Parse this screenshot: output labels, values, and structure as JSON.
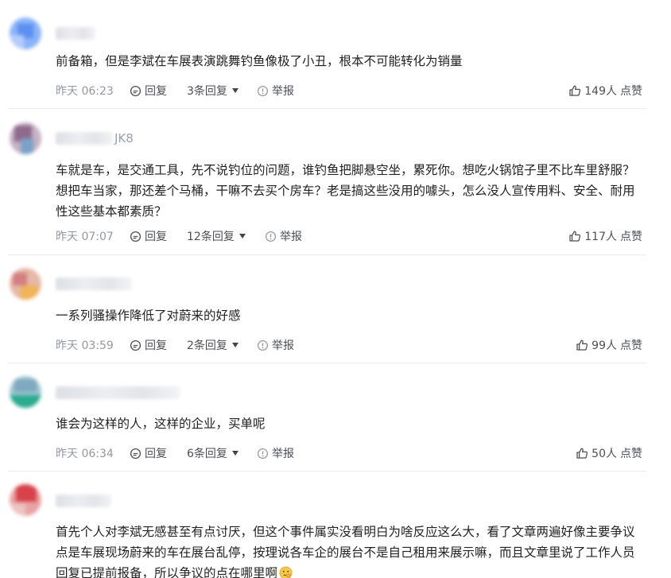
{
  "labels": {
    "reply": "回复",
    "report": "举报",
    "like": "点赞"
  },
  "colors": {
    "text": "#222222",
    "meta": "#9499a0",
    "divider": "#ececec"
  },
  "comments": [
    {
      "username_tail": "",
      "text": "前备箱，但是李斌在车展表演跳舞钓鱼像极了小丑，根本不可能转化为销量",
      "time": "昨天 06:23",
      "replies": "3条回复",
      "likes": "149人"
    },
    {
      "username_tail": "JK8",
      "text": "车就是车，是交通工具，先不说钓位的问题，谁钓鱼把脚悬空坐，累死你。想吃火锅馆子里不比车里舒服？想把车当家，那还差个马桶，干嘛不去买个房车？老是搞这些没用的噱头，怎么没人宣传用料、安全、耐用性这些基本都素质？",
      "time": "昨天 07:07",
      "replies": "12条回复",
      "likes": "117人"
    },
    {
      "username_tail": "",
      "text": "一系列骚操作降低了对蔚来的好感",
      "time": "昨天 03:59",
      "replies": "2条回复",
      "likes": "99人"
    },
    {
      "username_tail": "",
      "text": "谁会为这样的人，这样的企业，买单呢",
      "time": "昨天 06:34",
      "replies": "6条回复",
      "likes": "50人"
    },
    {
      "username_tail": "",
      "text": "首先个人对李斌无感甚至有点讨厌，但这个事件属实没看明白为啥反应这么大，看了文章两遍好像主要争议点是车展现场蔚来的车在展台乱停，按理说各车企的展台不是自己租用来展示嘛，而且文章里说了工作人员回复已提前报备，所以争议的点在哪里啊",
      "time": "",
      "replies": "",
      "likes": ""
    }
  ],
  "icons": {
    "reply": "comment-bubble-icon",
    "report": "warning-circle-icon",
    "like": "thumbs-up-icon",
    "replies_toggle": "caret-down-icon",
    "emoji": "thinking-face-emoji"
  }
}
